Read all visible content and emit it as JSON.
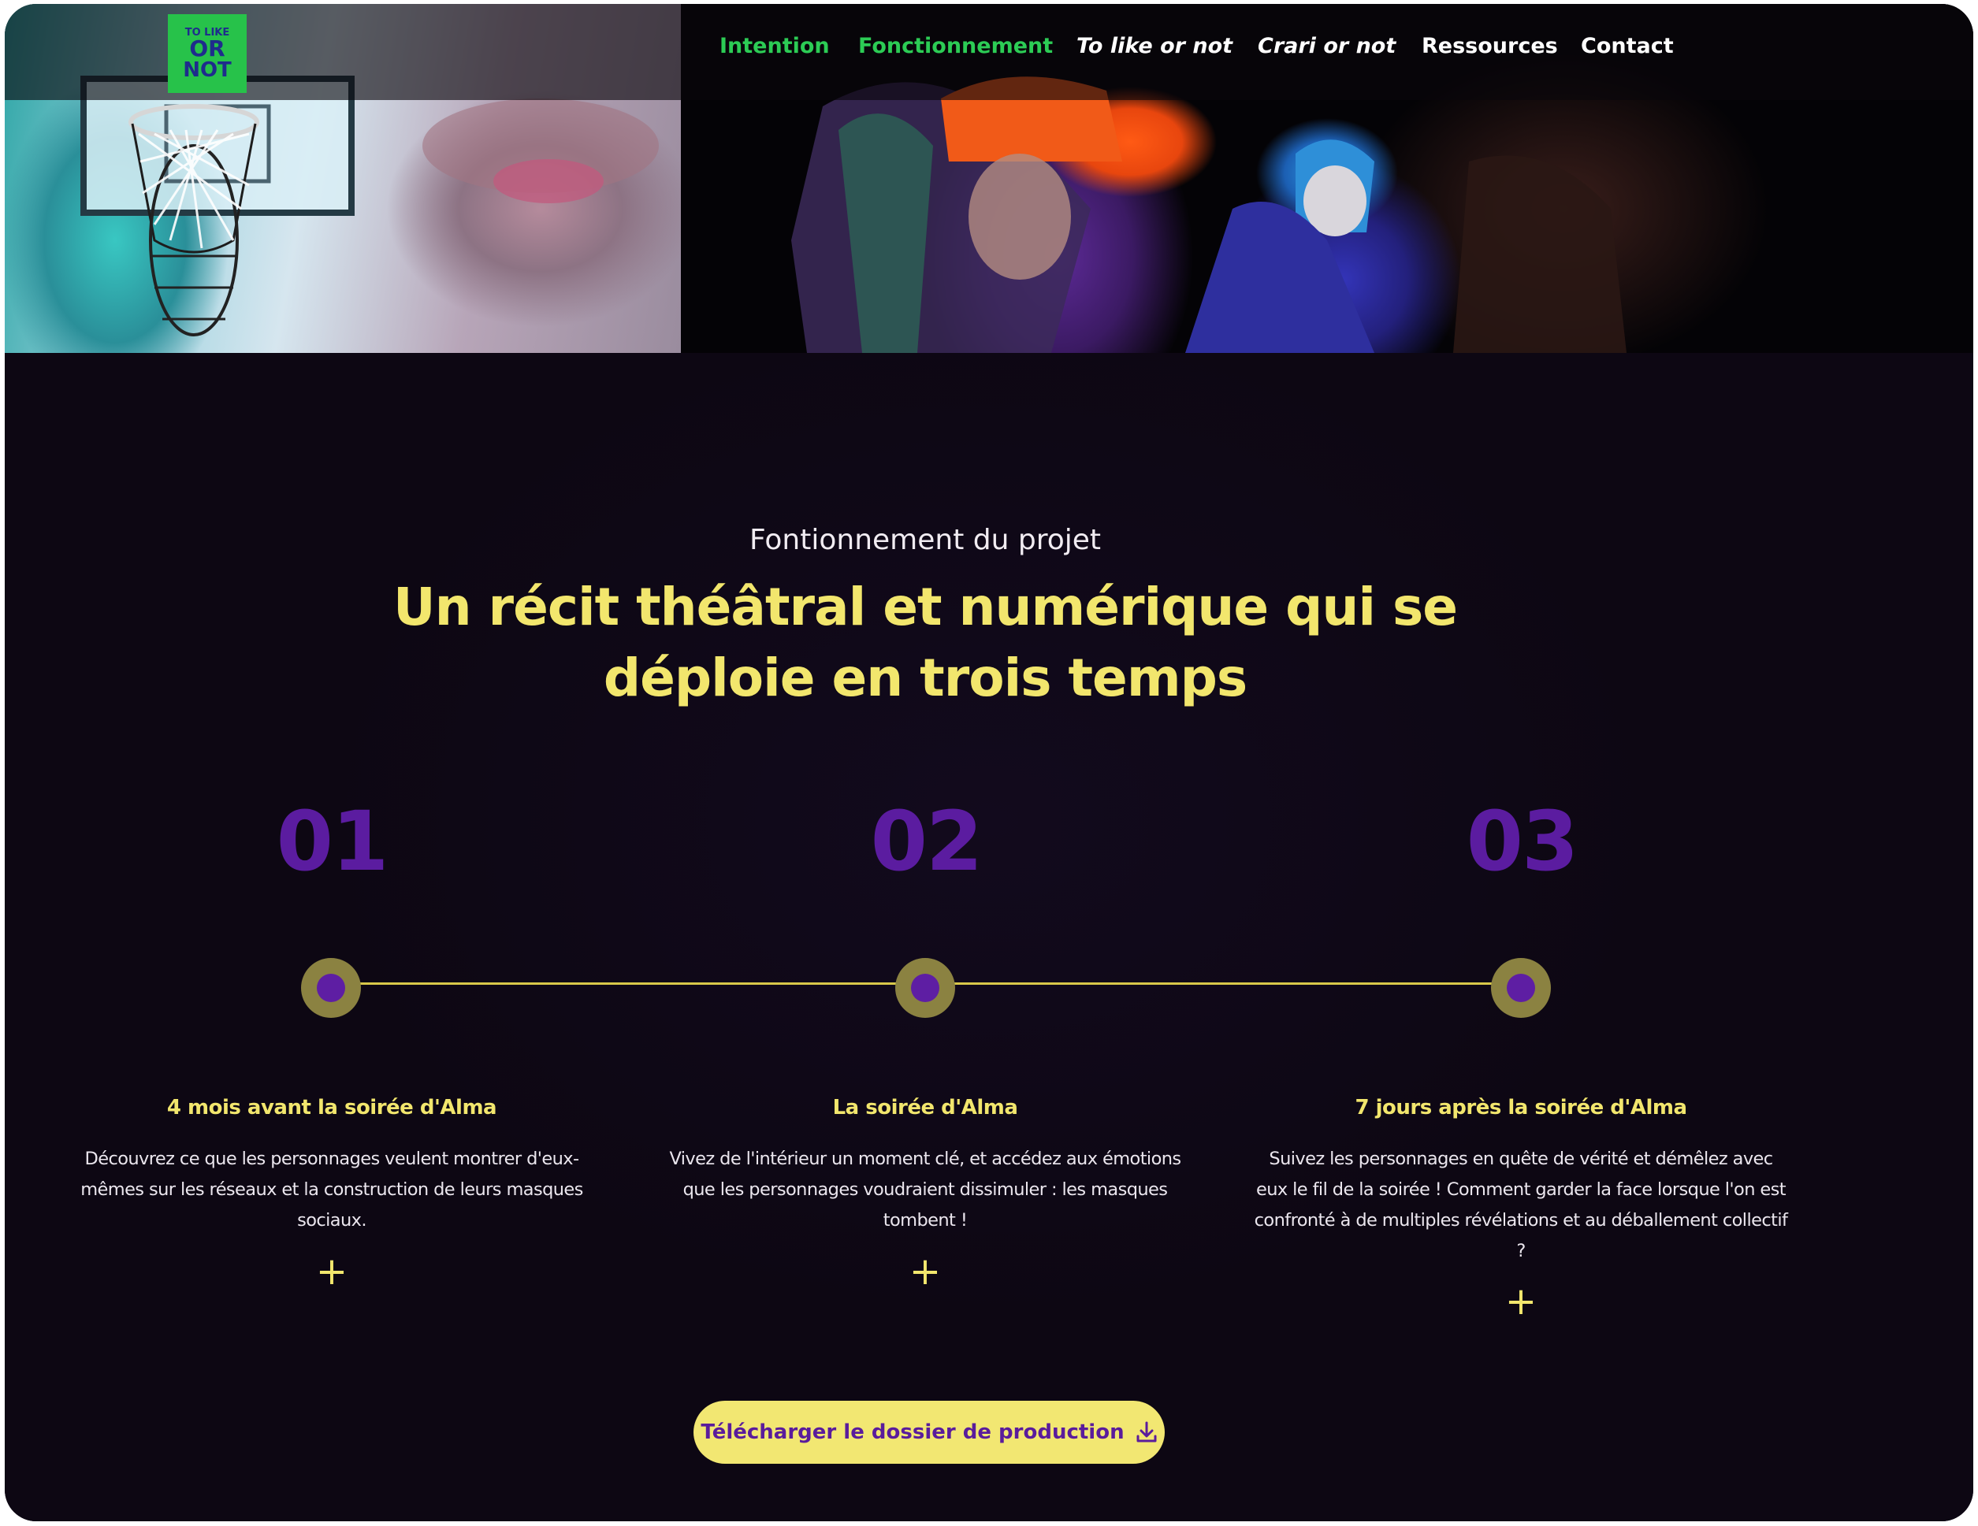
{
  "logo": {
    "line1": "TO LIKE",
    "line2": "OR",
    "line3": "NOT"
  },
  "nav": {
    "items": [
      {
        "label": "Intention",
        "state": "active"
      },
      {
        "label": "Fonctionnement",
        "state": "active"
      },
      {
        "label": "To like or not",
        "state": "italic"
      },
      {
        "label": "Crari or not",
        "state": "italic"
      },
      {
        "label": "Ressources",
        "state": "normal"
      },
      {
        "label": "Contact",
        "state": "normal"
      }
    ]
  },
  "section": {
    "eyebrow": "Fontionnement du projet",
    "headline_line1": "Un récit théâtral et numérique qui se",
    "headline_line2": "déploie en trois temps"
  },
  "steps": [
    {
      "number": "01",
      "title": "4 mois avant la soirée d'Alma",
      "description": "Découvrez ce que les personnages veulent montrer d'eux-mêmes sur les réseaux et la construction de leurs masques sociaux.",
      "expand_symbol": "+"
    },
    {
      "number": "02",
      "title": "La soirée d'Alma",
      "description": "Vivez de l'intérieur un moment clé, et accédez aux émotions que les personnages voudraient dissimuler : les masques tombent !",
      "expand_symbol": "+"
    },
    {
      "number": "03",
      "title": "7 jours après la soirée d'Alma",
      "description": "Suivez les personnages en quête de vérité et démêlez avec eux le fil de la soirée ! Comment garder la face lorsque l'on est confronté à de multiples révélations et au déballement collectif ?",
      "expand_symbol": "+"
    }
  ],
  "cta": {
    "label": "Télécharger le dossier de production",
    "icon": "download-icon"
  },
  "colors": {
    "accent_yellow": "#f2e66d",
    "accent_purple": "#5b1ca0",
    "accent_green": "#2ccc55",
    "background": "#0d0713"
  }
}
